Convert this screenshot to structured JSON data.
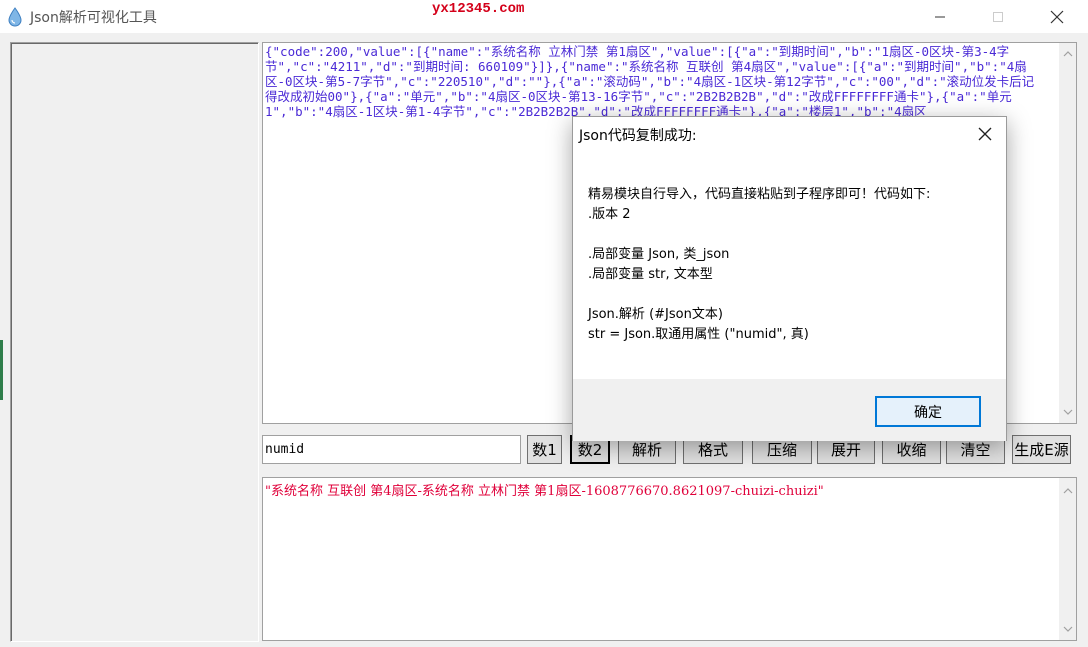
{
  "window": {
    "title": "Json解析可视化工具",
    "watermark": "yx12345.com",
    "buttons": {
      "minimize": "minimize",
      "maximize": "maximize",
      "close": "close"
    }
  },
  "json_text": "{\"code\":200,\"value\":[{\"name\":\"系统名称 立林门禁 第1扇区\",\"value\":[{\"a\":\"到期时间\",\"b\":\"1扇区-0区块-第3-4字节\",\"c\":\"4211\",\"d\":\"到期时间: 660109\"}]},{\"name\":\"系统名称 互联创 第4扇区\",\"value\":[{\"a\":\"到期时间\",\"b\":\"4扇区-0区块-第5-7字节\",\"c\":\"220510\",\"d\":\"\"},{\"a\":\"滚动码\",\"b\":\"4扇区-1区块-第12字节\",\"c\":\"00\",\"d\":\"滚动位发卡后记得改成初始00\"},{\"a\":\"单元\",\"b\":\"4扇区-0区块-第13-16字节\",\"c\":\"2B2B2B2B\",\"d\":\"改成FFFFFFFF通卡\"},{\"a\":\"单元1\",\"b\":\"4扇区-1区块-第1-4字节\",\"c\":\"2B2B2B2B\",\"d\":\"改成FFFFFFFF通卡\"},{\"a\":\"楼层1\",\"b\":\"4扇区",
  "json_text_bottom_fragment": "互联创 第4扇区-系统名称 立林门禁 第1扇区-",
  "search": {
    "value": "numid",
    "placeholder": ""
  },
  "toolbar": [
    {
      "id": "num1",
      "label": "数1"
    },
    {
      "id": "num2",
      "label": "数2"
    },
    {
      "id": "parse",
      "label": "解析"
    },
    {
      "id": "format",
      "label": "格式"
    },
    {
      "id": "compress",
      "label": "压缩"
    },
    {
      "id": "expand",
      "label": "展开"
    },
    {
      "id": "collapse",
      "label": "收缩"
    },
    {
      "id": "clear",
      "label": "清空"
    },
    {
      "id": "gen-source",
      "label": "生成E源"
    }
  ],
  "result_text": "\"系统名称 互联创 第4扇区-系统名称 立林门禁 第1扇区-1608776670.8621097-chuizi-chuizi\"",
  "dialog": {
    "title": "Json代码复制成功:",
    "lines": [
      "精易模块自行导入，代码直接粘贴到子程序即可！代码如下:",
      ".版本 2",
      "",
      ".局部变量 Json, 类_json",
      ".局部变量 str, 文本型",
      "",
      "Json.解析 (#Json文本)",
      "str = Json.取通用属性 (\"numid\", 真)"
    ],
    "ok_label": "确定"
  },
  "colors": {
    "json_text": "#4a2ad6",
    "result_text": "#e0003a",
    "watermark": "#d4001a",
    "dialog_ok_border": "#0078d7"
  }
}
